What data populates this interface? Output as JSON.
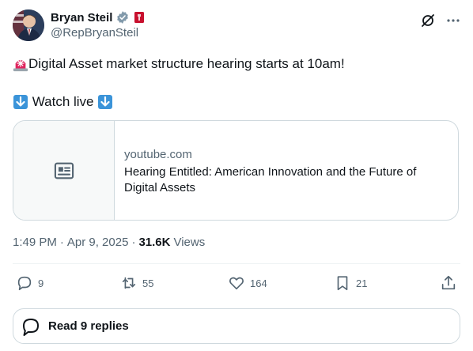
{
  "author": {
    "name": "Bryan Steil",
    "handle": "@RepBryanSteil",
    "verified_icon": "gray-verified-badge-icon",
    "affiliation_icon": "house-seal-icon"
  },
  "header_icons": [
    "grok-icon",
    "more-icon"
  ],
  "tweet": {
    "line1_emoji": "siren-emoji-icon",
    "line1_text": "Digital Asset market structure hearing starts at 10am!",
    "line2_prefix_emoji": "down-arrow-emoji-icon",
    "line2_text": " Watch live ",
    "line2_suffix_emoji": "down-arrow-emoji-icon"
  },
  "card": {
    "thumbnail_icon": "article-icon",
    "domain": "youtube.com",
    "title": "Hearing Entitled: American Innovation and the Future of Digital Assets"
  },
  "meta": {
    "time": "1:49 PM",
    "sep1": "·",
    "date": "Apr 9, 2025",
    "sep2": "·",
    "views_count": "31.6K",
    "views_label": "Views"
  },
  "actions": {
    "replies": "9",
    "reposts": "55",
    "likes": "164",
    "bookmarks": "21"
  },
  "read_replies": {
    "label": "Read 9 replies",
    "icon": "chat-bubble-icon"
  },
  "colors": {
    "text": "#0f1419",
    "muted": "#536471",
    "border": "#cfd9de",
    "siren_red": "#e0245e"
  }
}
